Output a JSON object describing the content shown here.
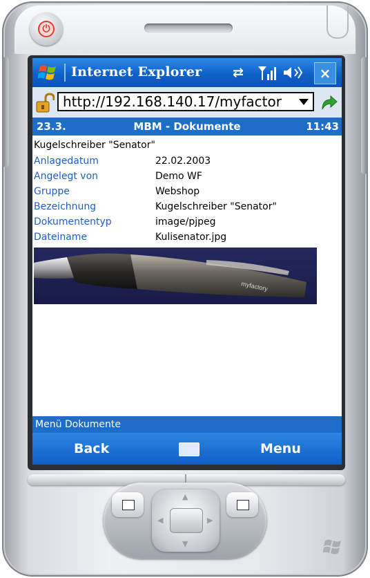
{
  "titlebar": {
    "app_title": "Internet Explorer",
    "icons": [
      "windows-start-icon",
      "connectivity-icon",
      "signal-icon",
      "volume-icon",
      "close-icon"
    ],
    "close_label": "×"
  },
  "address_bar": {
    "url": "http://192.168.140.17/myfactor"
  },
  "info_bar": {
    "date": "23.3.",
    "title": "MBM - Dokumente",
    "time": "11:43"
  },
  "document": {
    "heading": "Kugelschreiber \"Senator\"",
    "fields": [
      {
        "label": "Anlagedatum",
        "value": "22.02.2003"
      },
      {
        "label": "Angelegt von",
        "value": "Demo WF"
      },
      {
        "label": "Gruppe",
        "value": "Webshop"
      },
      {
        "label": "Bezeichnung",
        "value": "Kugelschreiber \"Senator\""
      },
      {
        "label": "Dokumententyp",
        "value": "image/pjpeg"
      },
      {
        "label": "Dateiname",
        "value": "Kulisenator.jpg"
      }
    ]
  },
  "status_bar": {
    "text": "Menü Dokumente"
  },
  "softkeys": {
    "left": "Back",
    "right": "Menu"
  },
  "colors": {
    "title_blue": "#0f61c8",
    "label_blue": "#1e5fc3",
    "bar_blue": "#1e6ec9",
    "power_red": "#e23a2e"
  }
}
